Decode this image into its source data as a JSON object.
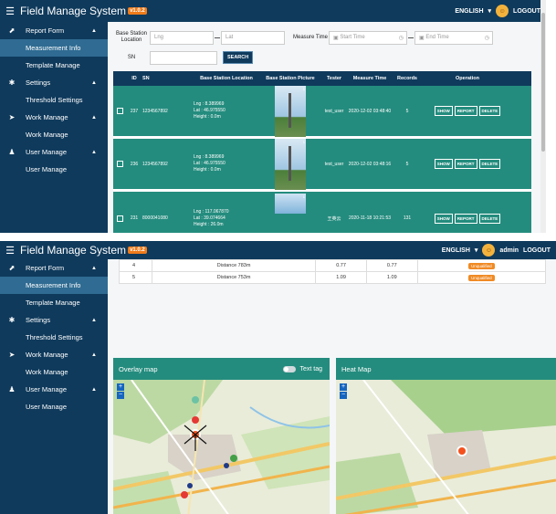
{
  "app": {
    "title": "Field Manage System",
    "version": "v1.0.2"
  },
  "header": {
    "language": "ENGLISH",
    "user": "admin",
    "logout": "LOGOUT"
  },
  "sidebar": {
    "items": [
      {
        "label": "Report Form",
        "icon": "chart-up-icon",
        "expanded": true
      },
      {
        "label": "Measurement Info",
        "sub": true,
        "active": true
      },
      {
        "label": "Template Manage",
        "sub": true
      },
      {
        "label": "Settings",
        "icon": "gear-icon",
        "expanded": true
      },
      {
        "label": "Threshold Settings",
        "sub": true
      },
      {
        "label": "Work Manage",
        "icon": "send-icon",
        "expanded": true
      },
      {
        "label": "Work Manage",
        "sub": true
      },
      {
        "label": "User Manage",
        "icon": "users-icon",
        "expanded": true
      },
      {
        "label": "User Manage",
        "sub": true
      }
    ]
  },
  "filters": {
    "base_station_location": "Base Station Location",
    "lng_placeholder": "Lng",
    "lat_placeholder": "Lat",
    "measure_time": "Measure Time",
    "start_time": "Start Time",
    "end_time": "End Time",
    "sn": "SN",
    "search": "SEARCH"
  },
  "table": {
    "columns": [
      "ID",
      "SN",
      "Base Station Location",
      "Base Station Picture",
      "Tester",
      "Measure Time",
      "Records",
      "Operation"
    ],
    "rows": [
      {
        "id": "237",
        "sn": "1234567892",
        "lng": "Lng : 8.389969",
        "lat": "Lat : 46.975550",
        "height": "Height : 0.0m",
        "pic_count": "1",
        "tester": "test_user",
        "time": "2020-12-02 03:48:40",
        "records": "5"
      },
      {
        "id": "236",
        "sn": "1234567892",
        "lng": "Lng : 8.389969",
        "lat": "Lat : 46.975550",
        "height": "Height : 0.0m",
        "pic_count": "1",
        "tester": "test_user",
        "time": "2020-12-02 03:48:16",
        "records": "5"
      },
      {
        "id": "231",
        "sn": "8000041080",
        "lng": "Lng : 117.067870",
        "lat": "Lat : 39.074664",
        "height": "Height : 26.0m",
        "pic_count": "1",
        "tester": "王英云",
        "time": "2020-11-18 10:21:53",
        "records": "131"
      }
    ],
    "ops": {
      "show": "SHOW",
      "report": "REPORT",
      "delete": "DELETE"
    }
  },
  "records": [
    {
      "n": "4",
      "distance": "Distance 783m",
      "v1": "0.77",
      "v2": "0.77",
      "status": "Unqualified"
    },
    {
      "n": "5",
      "distance": "Distance 753m",
      "v1": "1.09",
      "v2": "1.09",
      "status": "Unqualified"
    }
  ],
  "overlay_map": {
    "title": "Overlay map",
    "text_tag": "Text tag",
    "zoom_in": "+",
    "zoom_out": "−"
  },
  "heat_map": {
    "title": "Heat Map",
    "zoom_in": "+",
    "zoom_out": "−"
  },
  "colors": {
    "nav": "#0f3a5c",
    "teal": "#248c7e",
    "badge": "#f08a24",
    "version": "#f07b1a"
  }
}
